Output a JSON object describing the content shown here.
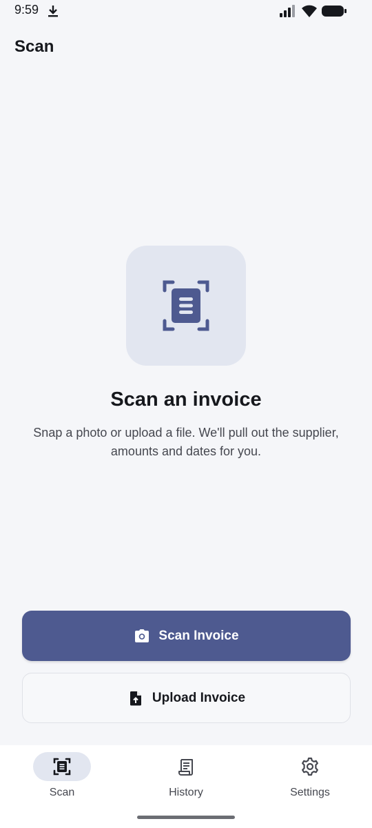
{
  "status_bar": {
    "time": "9:59"
  },
  "header": {
    "title": "Scan"
  },
  "hero": {
    "heading": "Scan an invoice",
    "subtext": "Snap a photo or upload a file. We'll pull out the supplier, amounts and dates for you."
  },
  "actions": {
    "scan_label": "Scan Invoice",
    "upload_label": "Upload Invoice"
  },
  "nav": {
    "items": [
      {
        "label": "Scan",
        "icon": "scan-icon",
        "active": true
      },
      {
        "label": "History",
        "icon": "receipt-icon",
        "active": false
      },
      {
        "label": "Settings",
        "icon": "gear-icon",
        "active": false
      }
    ]
  },
  "colors": {
    "primary": "#4e5a90",
    "background": "#f5f6f9",
    "tile": "#e2e6f0"
  }
}
